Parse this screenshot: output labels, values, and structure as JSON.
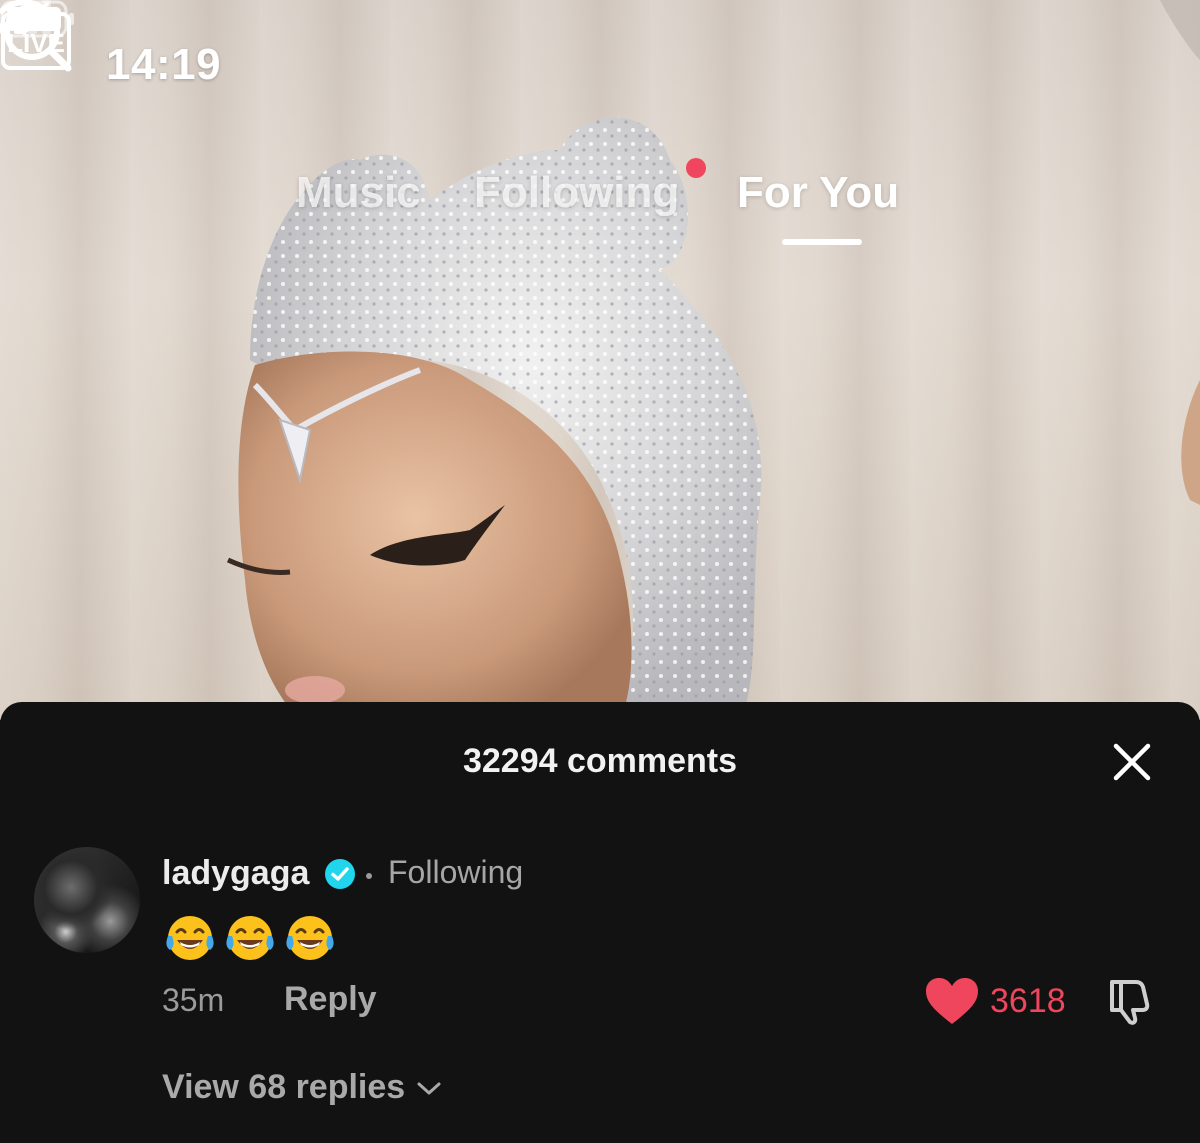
{
  "status_bar": {
    "time": "14:19",
    "icons": [
      "cellular-signal-icon",
      "wifi-icon",
      "battery-icon"
    ]
  },
  "top_nav": {
    "live_label": "LIVE",
    "tabs": [
      {
        "label": "Music",
        "active": false
      },
      {
        "label": "Following",
        "active": false,
        "notification_dot": true
      },
      {
        "label": "For You",
        "active": true
      }
    ],
    "icons": [
      "live-tv-icon",
      "search-icon"
    ]
  },
  "comments_sheet": {
    "title": "32294 comments",
    "close_icon": "close-icon",
    "comments": [
      {
        "username": "ladygaga",
        "verified": true,
        "relationship": "Following",
        "text": "😂😂😂",
        "time": "35m",
        "reply_label": "Reply",
        "likes": "3618",
        "liked": true,
        "view_replies_label": "View 68 replies"
      }
    ]
  },
  "colors": {
    "accent": "#f0465d",
    "sheet_bg": "#121212",
    "verified": "#20d5ec"
  }
}
